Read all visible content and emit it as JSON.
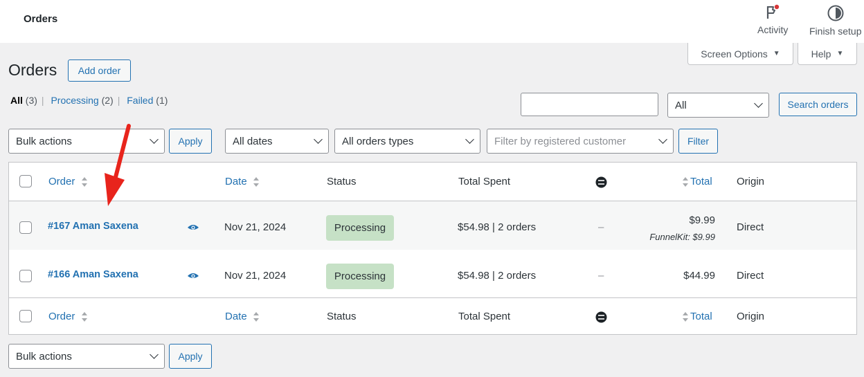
{
  "topbar": {
    "title": "Orders",
    "activity_label": "Activity",
    "finish_setup_label": "Finish setup"
  },
  "tabs": {
    "screen_options": "Screen Options",
    "help": "Help"
  },
  "page": {
    "title": "Orders",
    "add_order": "Add order"
  },
  "views": [
    {
      "label": "All",
      "count": "(3)"
    },
    {
      "label": "Processing",
      "count": "(2)"
    },
    {
      "label": "Failed",
      "count": "(1)"
    }
  ],
  "search": {
    "input_value": "",
    "status_select": "All",
    "button": "Search orders"
  },
  "filters": {
    "bulk_actions": "Bulk actions",
    "apply": "Apply",
    "dates": "All dates",
    "order_types": "All orders types",
    "customer_placeholder": "Filter by registered customer",
    "filter_button": "Filter"
  },
  "columns": {
    "order": "Order",
    "date": "Date",
    "status": "Status",
    "total_spent": "Total Spent",
    "total": "Total",
    "origin": "Origin"
  },
  "rows": [
    {
      "order": "#167 Aman Saxena",
      "date": "Nov 21, 2024",
      "status": "Processing",
      "total_spent": "$54.98 | 2 orders",
      "attribution": "–",
      "total": "$9.99",
      "total_note": "FunnelKit: $9.99",
      "origin": "Direct"
    },
    {
      "order": "#166 Aman Saxena",
      "date": "Nov 21, 2024",
      "status": "Processing",
      "total_spent": "$54.98 | 2 orders",
      "attribution": "–",
      "total": "$44.99",
      "origin": "Direct"
    }
  ],
  "bottom": {
    "bulk_actions": "Bulk actions",
    "apply": "Apply"
  },
  "colors": {
    "link": "#2271b1",
    "status_processing_bg": "#c6e1c6",
    "annotation_arrow": "#e8241c"
  }
}
